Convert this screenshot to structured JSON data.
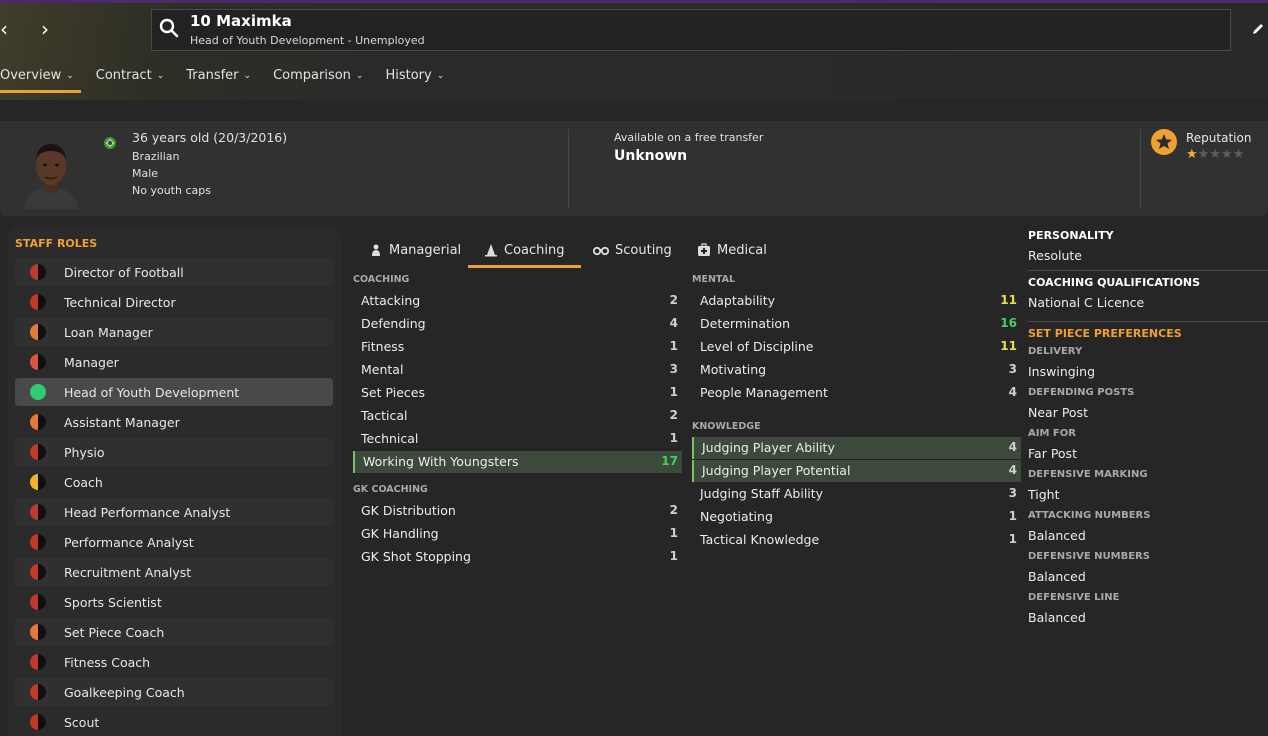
{
  "header": {
    "title": "10 Maximka",
    "subtitle": "Head of Youth Development - Unemployed",
    "tabs": [
      {
        "label": "Overview"
      },
      {
        "label": "Contract"
      },
      {
        "label": "Transfer"
      },
      {
        "label": "Comparison"
      },
      {
        "label": "History"
      }
    ]
  },
  "profile": {
    "age": "36 years old (20/3/2016)",
    "nationality": "Brazilian",
    "gender": "Male",
    "caps": "No youth caps",
    "transfer_label": "Available on a free transfer",
    "transfer_value": "Unknown",
    "reputation_label": "Reputation",
    "reputation_stars": 1,
    "reputation_max": 5
  },
  "staff_roles": {
    "title": "STAFF ROLES",
    "items": [
      {
        "label": "Director of Football",
        "suitability": "poor",
        "color": "#c0392b"
      },
      {
        "label": "Technical Director",
        "suitability": "poor",
        "color": "#c0392b"
      },
      {
        "label": "Loan Manager",
        "suitability": "fair",
        "color": "#e8783a"
      },
      {
        "label": "Manager",
        "suitability": "poor",
        "color": "#d9553f"
      },
      {
        "label": "Head of Youth Development",
        "suitability": "best",
        "color": "#2ecc71"
      },
      {
        "label": "Assistant Manager",
        "suitability": "fair",
        "color": "#e8783a"
      },
      {
        "label": "Physio",
        "suitability": "poor",
        "color": "#c0392b"
      },
      {
        "label": "Coach",
        "suitability": "good",
        "color": "#f0b429"
      },
      {
        "label": "Head Performance Analyst",
        "suitability": "poor",
        "color": "#c0392b"
      },
      {
        "label": "Performance Analyst",
        "suitability": "poor",
        "color": "#c0392b"
      },
      {
        "label": "Recruitment Analyst",
        "suitability": "poor",
        "color": "#c0392b"
      },
      {
        "label": "Sports Scientist",
        "suitability": "poor",
        "color": "#c0392b"
      },
      {
        "label": "Set Piece Coach",
        "suitability": "fair",
        "color": "#e8783a"
      },
      {
        "label": "Fitness Coach",
        "suitability": "poor",
        "color": "#c0392b"
      },
      {
        "label": "Goalkeeping Coach",
        "suitability": "poor",
        "color": "#c0392b"
      },
      {
        "label": "Scout",
        "suitability": "poor",
        "color": "#c0392b"
      }
    ]
  },
  "subtabs": [
    {
      "label": "Managerial",
      "icon": "managerial-icon"
    },
    {
      "label": "Coaching",
      "icon": "coaching-cone-icon"
    },
    {
      "label": "Scouting",
      "icon": "binoculars-icon"
    },
    {
      "label": "Medical",
      "icon": "medical-kit-icon"
    }
  ],
  "coaching": {
    "title": "COACHING",
    "items": [
      {
        "name": "Attacking",
        "value": "2"
      },
      {
        "name": "Defending",
        "value": "4"
      },
      {
        "name": "Fitness",
        "value": "1"
      },
      {
        "name": "Mental",
        "value": "3"
      },
      {
        "name": "Set Pieces",
        "value": "1"
      },
      {
        "name": "Tactical",
        "value": "2"
      },
      {
        "name": "Technical",
        "value": "1"
      },
      {
        "name": "Working With Youngsters",
        "value": "17"
      }
    ]
  },
  "gk_coaching": {
    "title": "GK COACHING",
    "items": [
      {
        "name": "GK Distribution",
        "value": "2"
      },
      {
        "name": "GK Handling",
        "value": "1"
      },
      {
        "name": "GK Shot Stopping",
        "value": "1"
      }
    ]
  },
  "mental": {
    "title": "MENTAL",
    "items": [
      {
        "name": "Adaptability",
        "value": "11"
      },
      {
        "name": "Determination",
        "value": "16"
      },
      {
        "name": "Level of Discipline",
        "value": "11"
      },
      {
        "name": "Motivating",
        "value": "3"
      },
      {
        "name": "People Management",
        "value": "4"
      }
    ]
  },
  "knowledge": {
    "title": "KNOWLEDGE",
    "items": [
      {
        "name": "Judging Player Ability",
        "value": "4"
      },
      {
        "name": "Judging Player Potential",
        "value": "4"
      },
      {
        "name": "Judging Staff Ability",
        "value": "3"
      },
      {
        "name": "Negotiating",
        "value": "1"
      },
      {
        "name": "Tactical Knowledge",
        "value": "1"
      }
    ]
  },
  "right": {
    "personality_title": "PERSONALITY",
    "personality": "Resolute",
    "qual_title": "COACHING QUALIFICATIONS",
    "qualification": "National C Licence",
    "setpiece_title": "SET PIECE PREFERENCES",
    "prefs": [
      {
        "label": "DELIVERY",
        "value": "Inswinging"
      },
      {
        "label": "DEFENDING POSTS",
        "value": "Near Post"
      },
      {
        "label": "AIM FOR",
        "value": "Far Post"
      },
      {
        "label": "DEFENSIVE MARKING",
        "value": "Tight"
      },
      {
        "label": "ATTACKING NUMBERS",
        "value": "Balanced"
      },
      {
        "label": "DEFENSIVE NUMBERS",
        "value": "Balanced"
      },
      {
        "label": "DEFENSIVE LINE",
        "value": "Balanced"
      }
    ]
  },
  "colors": {
    "accent": "#f0a030",
    "high_value": "#3fd45f",
    "mid_value": "#e4e43a",
    "highlight_row": "#3d4a3b"
  }
}
